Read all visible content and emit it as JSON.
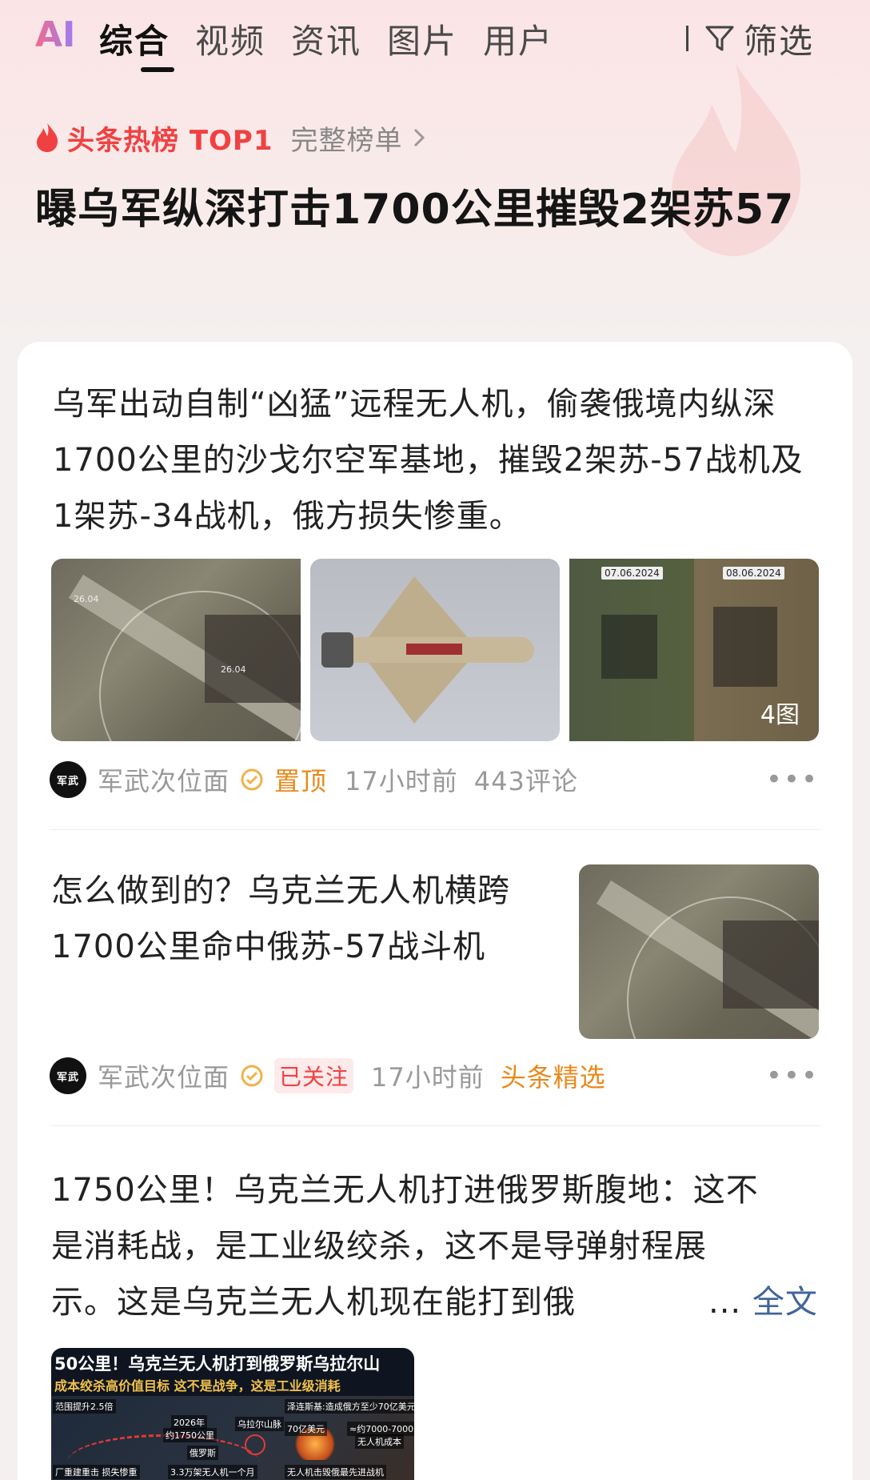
{
  "tabs": {
    "ai": "AI",
    "items": [
      "综合",
      "视频",
      "资讯",
      "图片",
      "用户"
    ],
    "active_index": 0,
    "filter_label": "筛选"
  },
  "hot": {
    "label": "头条热榜 TOP1",
    "full_list": "完整榜单",
    "headline": "曝乌军纵深打击1700公里摧毁2架苏57"
  },
  "articles": [
    {
      "text": "乌军出动自制“凶猛”远程无人机，偷袭俄境内纵深1700公里的沙戈尔空军基地，摧毁2架苏-57战机及1架苏-34战机，俄方损失惨重。",
      "images": {
        "sat_labels": [
          "26.04",
          "26.04"
        ],
        "dates": [
          "07.06.2024",
          "08.06.2024"
        ],
        "count": "4图"
      },
      "source": "军武次位面",
      "avatar_text": "军武",
      "tag": "置顶",
      "time": "17小时前",
      "comments": "443评论"
    },
    {
      "text": "怎么做到的？乌克兰无人机横跨1700公里命中俄苏-57战斗机",
      "source": "军武次位面",
      "avatar_text": "军武",
      "follow": "已关注",
      "time": "17小时前",
      "tag": "头条精选"
    },
    {
      "text": "1750公里！乌克兰无人机打进俄罗斯腹地：这不是消耗战，是工业级绞杀，这不是导弹射程展示。这是乌克兰无人机现在能打到俄",
      "ellipsis": "...",
      "full_text": "全文",
      "image": {
        "title": "50公里！乌克兰无人机打到俄罗斯乌拉尔山",
        "subtitle": "成本绞杀高价值目标  这不是战争，这是工业级消耗",
        "chips": [
          "范围提升2.5倍",
          "2026年",
          "约1750公里",
          "乌拉尔山脉",
          "俄罗斯",
          "泽连斯基:造成俄方至少70亿美元",
          "70亿美元",
          "≈约7000-7000",
          "无人机成本",
          "厂重建重击 损失惨重",
          "3.3万架无人机一个月",
          "无人机击毁俄最先进战机"
        ]
      }
    }
  ],
  "colors": {
    "hot_red": "#f04142",
    "pin_orange": "#e8891b",
    "link_blue": "#406599"
  }
}
